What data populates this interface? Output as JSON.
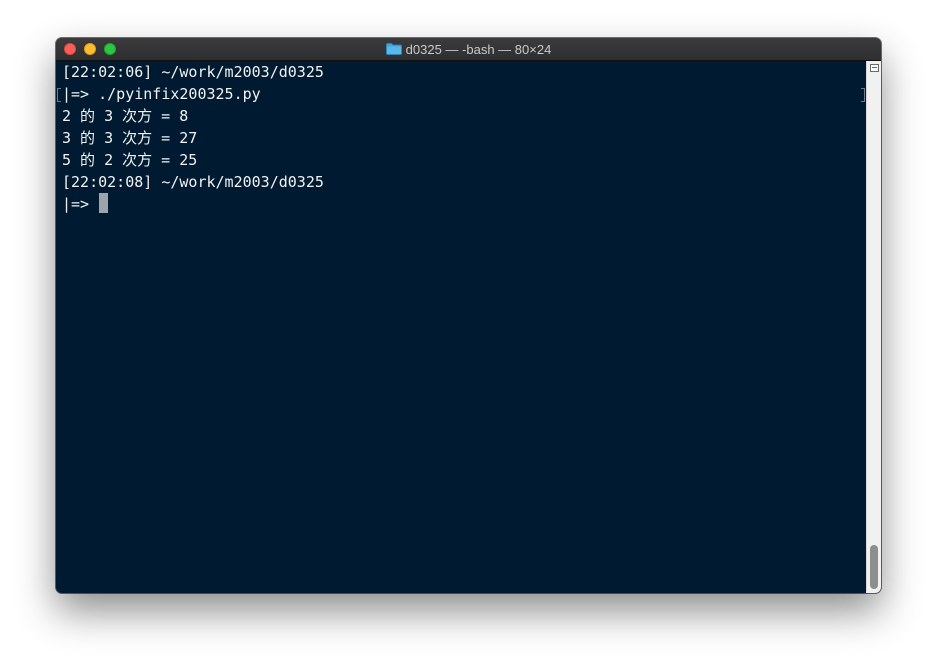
{
  "window": {
    "title": "d0325 — -bash — 80×24",
    "icon": "folder-icon"
  },
  "terminal": {
    "lines": [
      "[22:02:06] ~/work/m2003/d0325",
      "|=> ./pyinfix200325.py",
      "2 的 3 次方 = 8",
      "3 的 3 次方 = 27",
      "5 的 2 次方 = 25",
      "[22:02:08] ~/work/m2003/d0325",
      "|=> "
    ]
  },
  "colors": {
    "background": "#001b31",
    "text": "#f2f2f2",
    "cursor": "#9ea4a9"
  }
}
